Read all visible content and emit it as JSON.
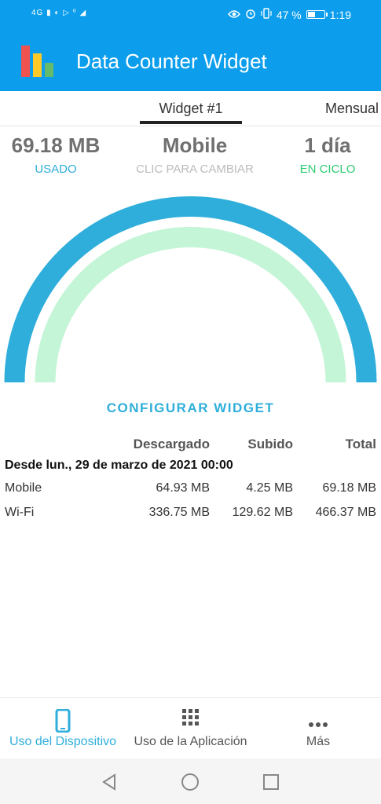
{
  "status_bar": {
    "left_indicators": "4G ▮ ◐ ▷ ⁰ ◢",
    "battery_percent": "47 %",
    "battery_level": 0.47,
    "time": "1:19"
  },
  "app": {
    "title": "Data Counter Widget"
  },
  "tabs": [
    {
      "label": "Widget #1",
      "selected": true
    },
    {
      "label": "Mensual",
      "selected": false
    }
  ],
  "stats": {
    "used": {
      "value": "69.18 MB",
      "label": "USADO"
    },
    "network": {
      "value": "Mobile",
      "label": "CLIC PARA CAMBIAR"
    },
    "cycle": {
      "value": "1 día",
      "label": "EN CICLO"
    }
  },
  "gauge": {
    "usage_fraction": 1.0,
    "cycle_fraction": 1.0,
    "outer_color": "#2faedb",
    "inner_color": "#c3f5d6"
  },
  "configure_label": "CONFIGURAR WIDGET",
  "table": {
    "headers": [
      "Descargado",
      "Subido",
      "Total"
    ],
    "since": "Desde lun., 29 de marzo de 2021 00:00",
    "rows": [
      {
        "name": "Mobile",
        "down": "64.93 MB",
        "up": "4.25 MB",
        "total": "69.18 MB"
      },
      {
        "name": "Wi-Fi",
        "down": "336.75 MB",
        "up": "129.62 MB",
        "total": "466.37 MB"
      }
    ]
  },
  "bottom_nav": [
    {
      "label": "Uso del Dispositivo",
      "icon": "phone-icon",
      "active": true
    },
    {
      "label": "Uso de la Aplicación",
      "icon": "grid-icon",
      "active": false
    },
    {
      "label": "Más",
      "icon": "more-icon",
      "active": false
    }
  ],
  "colors": {
    "accent": "#2faedb",
    "appbar": "#0c9eec",
    "used_label": "#2faedb",
    "cycle_label": "#2ecc71",
    "hint_label": "#bbbbbb"
  }
}
